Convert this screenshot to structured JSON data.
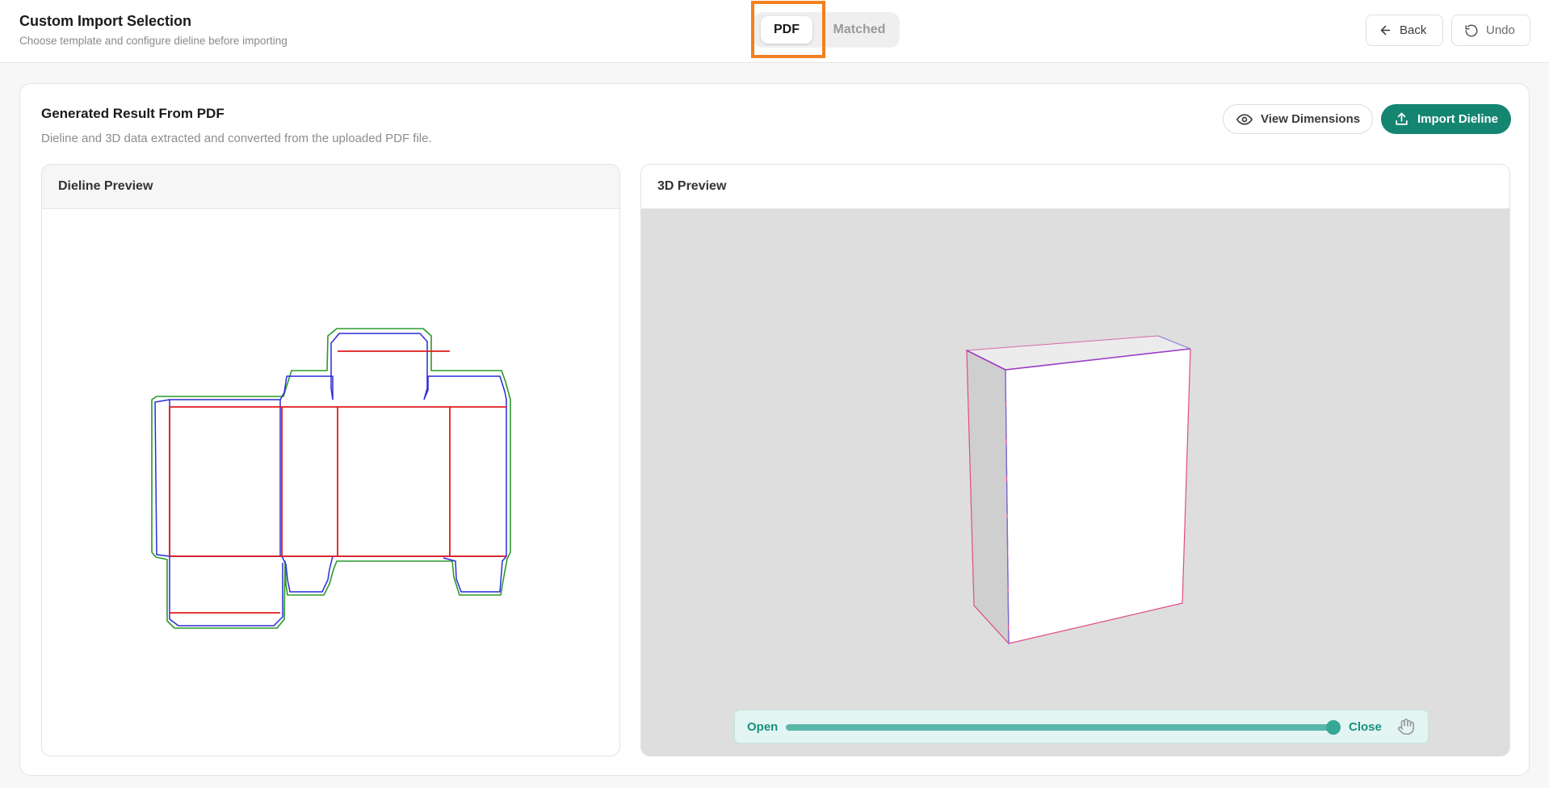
{
  "header": {
    "title": "Custom Import Selection",
    "subtitle": "Choose template and configure dieline before importing",
    "tabs": [
      {
        "label": "PDF",
        "selected": true
      },
      {
        "label": "Matched",
        "selected": false
      }
    ],
    "back_label": "Back",
    "undo_label": "Undo",
    "highlight_color": "#f2801e"
  },
  "card": {
    "title": "Generated Result From PDF",
    "subtitle": "Dieline and 3D data extracted and converted from the uploaded PDF file.",
    "view_dimensions_label": "View Dimensions",
    "import_dieline_label": "Import Dieline",
    "accent_color": "#138571"
  },
  "dieline_panel": {
    "title": "Dieline Preview",
    "line_colors": {
      "cut": "#2b2bd8",
      "fold": "#e01b1b",
      "bleed": "#2a9a2a"
    }
  },
  "preview_panel": {
    "title": "3D Preview",
    "slider": {
      "open_label": "Open",
      "close_label": "Close",
      "value": 1.0
    }
  },
  "icons": {
    "back": "arrow-left-icon",
    "undo": "undo-icon",
    "view": "eye-icon",
    "import": "upload-icon",
    "pan": "hand-icon"
  }
}
